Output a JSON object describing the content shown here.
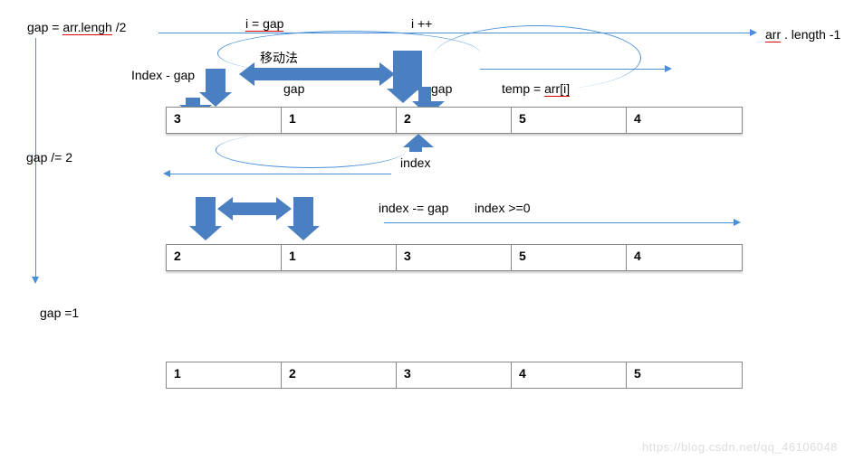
{
  "labels": {
    "gap_init": "gap = ",
    "gap_init_expr": "arr.lengh",
    "gap_init_tail": " /2",
    "i_eq_gap": "i = gap",
    "i_pp": "i ++",
    "arr_len_m1_a": "arr",
    "arr_len_m1_b": " . length -1",
    "index_minus_gap": "Index - gap",
    "method": "移动法",
    "gap_mid1": "gap",
    "gap_mid2": "gap",
    "temp_eq_a": "temp = ",
    "temp_eq_b": "arr[i]",
    "index_lbl": "index",
    "gap_div2": "gap /= 2",
    "cond_dec": "index -= gap",
    "cond_ge": "index >=0",
    "gap_eq1": "gap =1"
  },
  "arrays": {
    "r1": [
      "3",
      "1",
      "2",
      "5",
      "4"
    ],
    "r2": [
      "2",
      "1",
      "3",
      "5",
      "4"
    ],
    "r3": [
      "1",
      "2",
      "3",
      "4",
      "5"
    ]
  },
  "watermark": "https://blog.csdn.net/qq_46106048",
  "chart_data": {
    "type": "table",
    "title": "Shell sort (移动法) illustration",
    "rows": [
      {
        "gap_stage": "gap = arr.length/2",
        "array": [
          3,
          1,
          2,
          5,
          4
        ]
      },
      {
        "gap_stage": "gap /= 2",
        "array": [
          2,
          1,
          3,
          5,
          4
        ]
      },
      {
        "gap_stage": "gap = 1",
        "array": [
          1,
          2,
          3,
          4,
          5
        ]
      }
    ],
    "loop_vars": {
      "outer": "i = gap; i++; i <= arr.length-1",
      "inner": "index -= gap; index >= 0",
      "temp": "temp = arr[i]"
    }
  }
}
